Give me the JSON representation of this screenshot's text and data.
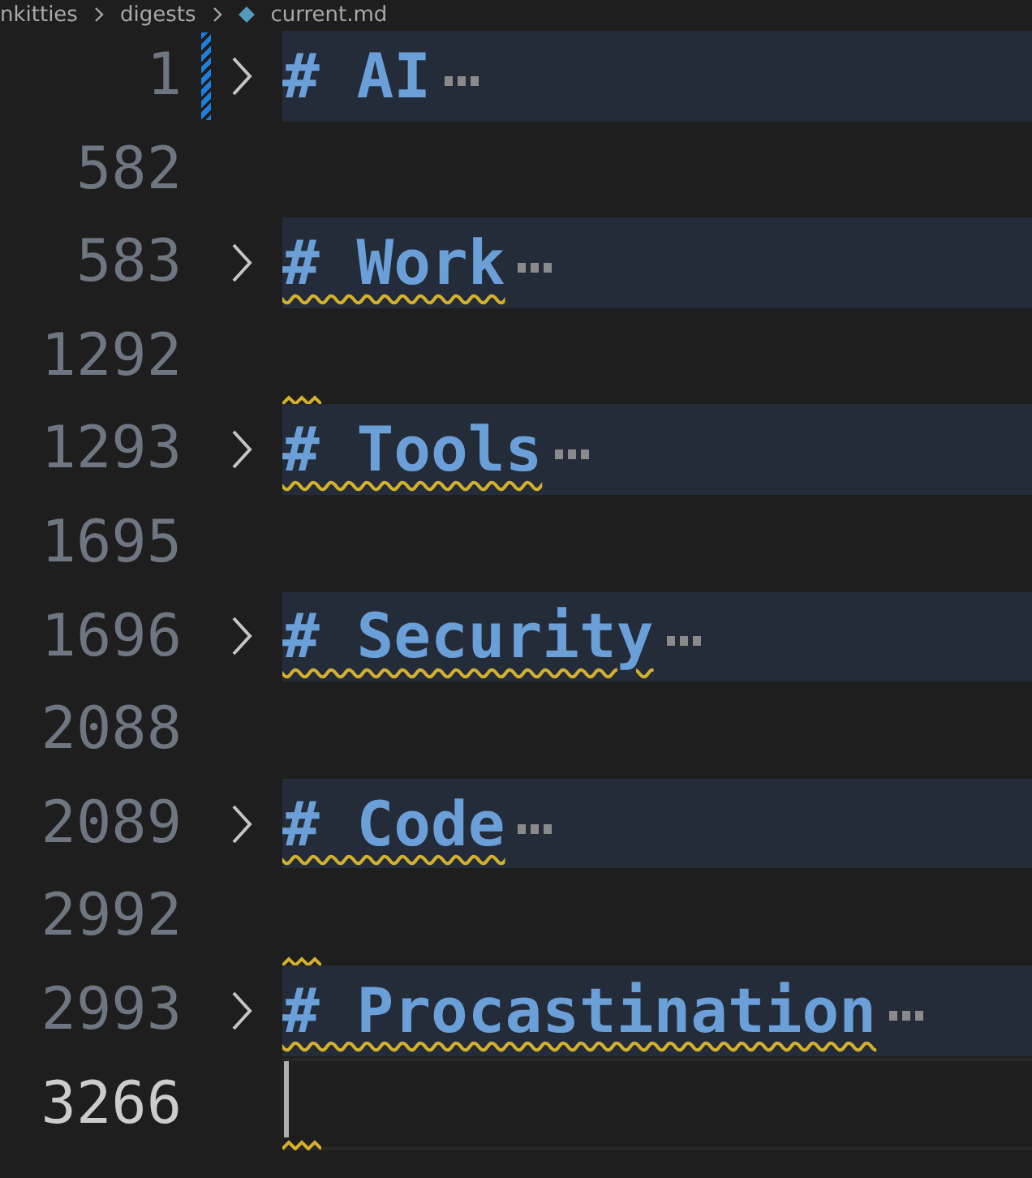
{
  "breadcrumb": [
    "nkitties",
    "digests",
    "current.md"
  ],
  "lines": [
    {
      "number": "1",
      "kind": "heading",
      "text": "# AI",
      "warning": false,
      "modified": true,
      "current": false
    },
    {
      "number": "582",
      "kind": "blank",
      "warning": false,
      "modified": false,
      "current": false
    },
    {
      "number": "583",
      "kind": "heading",
      "text": "# Work",
      "warning": true,
      "modified": false,
      "current": false
    },
    {
      "number": "1292",
      "kind": "blank",
      "warning": true,
      "modified": false,
      "current": false
    },
    {
      "number": "1293",
      "kind": "heading",
      "text": "# Tools",
      "warning": true,
      "modified": false,
      "current": false
    },
    {
      "number": "1695",
      "kind": "blank",
      "warning": false,
      "modified": false,
      "current": false
    },
    {
      "number": "1696",
      "kind": "heading",
      "text": "# Security",
      "warning": true,
      "modified": false,
      "current": false
    },
    {
      "number": "2088",
      "kind": "blank",
      "warning": false,
      "modified": false,
      "current": false
    },
    {
      "number": "2089",
      "kind": "heading",
      "text": "# Code",
      "warning": true,
      "modified": false,
      "current": false
    },
    {
      "number": "2992",
      "kind": "blank",
      "warning": true,
      "modified": false,
      "current": false
    },
    {
      "number": "2993",
      "kind": "heading",
      "text": "# Procastination",
      "warning": true,
      "modified": false,
      "current": false
    },
    {
      "number": "3266",
      "kind": "blank",
      "warning": true,
      "modified": false,
      "current": true
    }
  ]
}
